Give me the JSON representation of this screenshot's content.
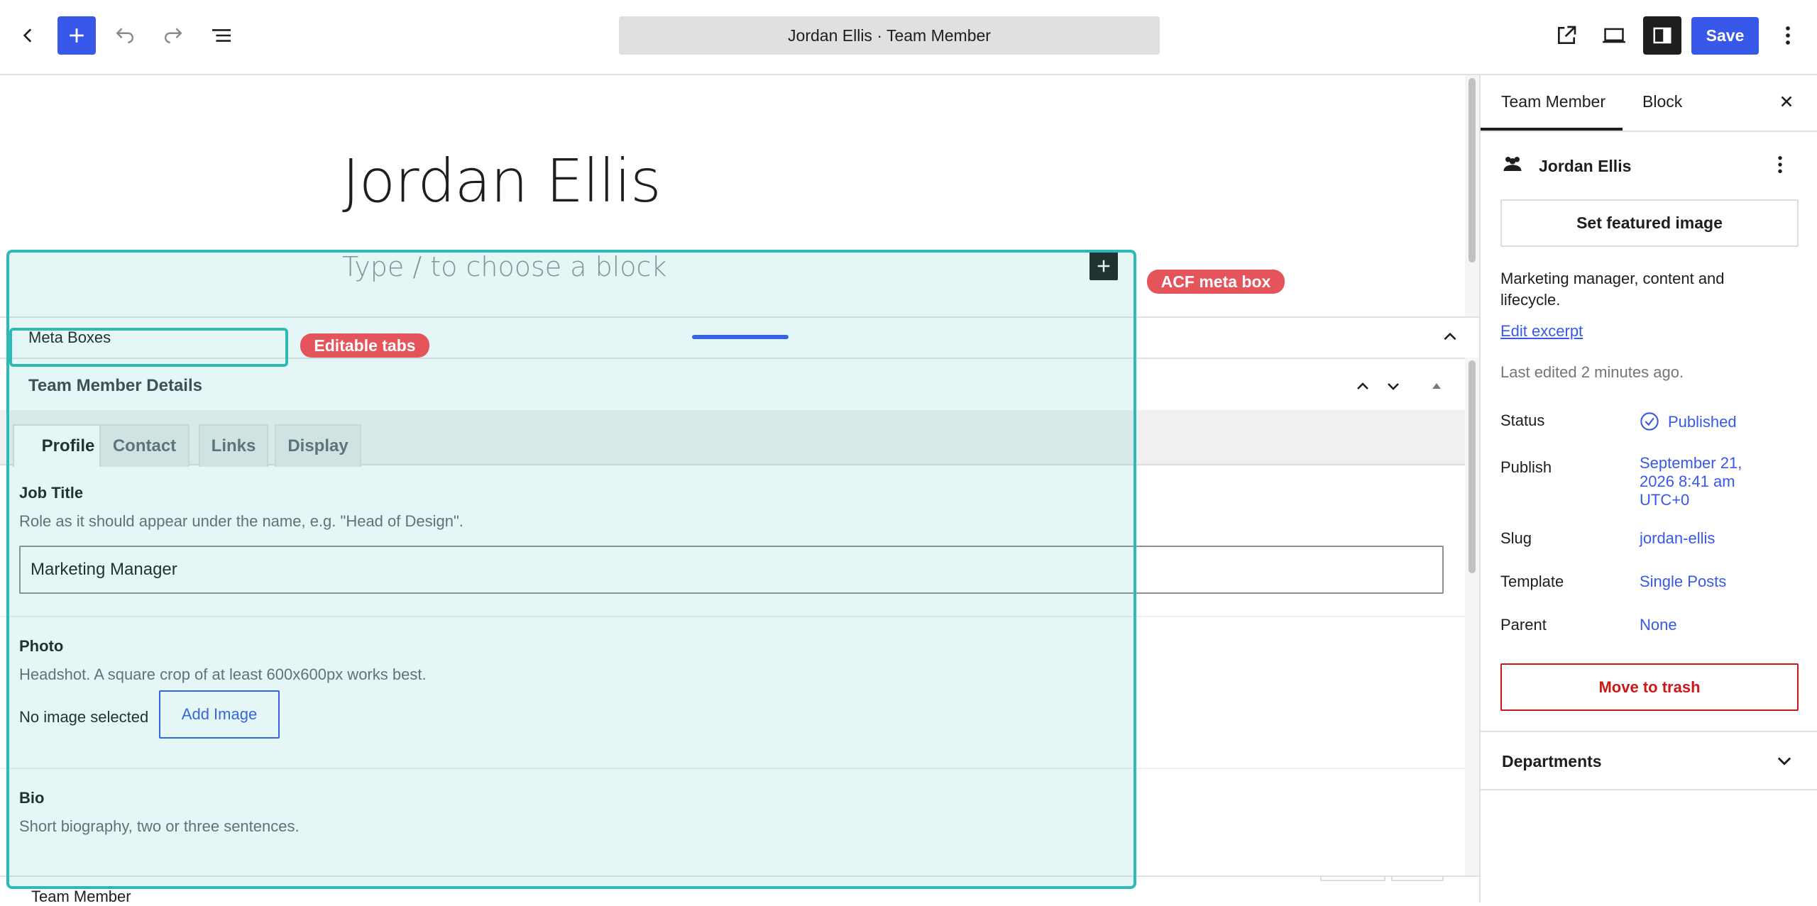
{
  "header": {
    "document_title": "Jordan Ellis · Team Member",
    "save_label": "Save"
  },
  "editor": {
    "post_title": "Jordan Ellis",
    "block_placeholder": "Type / to choose a block"
  },
  "meta_boxes": {
    "section_label": "Meta Boxes",
    "box_title": "Team Member Details",
    "tabs": [
      {
        "label": "Profile",
        "active": true
      },
      {
        "label": "Contact",
        "active": false
      },
      {
        "label": "Links",
        "active": false
      },
      {
        "label": "Display",
        "active": false
      }
    ],
    "fields": {
      "job_title": {
        "label": "Job Title",
        "description": "Role as it should appear under the name, e.g. \"Head of Design\".",
        "value": "Marketing Manager"
      },
      "photo": {
        "label": "Photo",
        "description": "Headshot. A square crop of at least 600x600px works best.",
        "status": "No image selected",
        "button": "Add Image"
      },
      "bio": {
        "label": "Bio",
        "description": "Short biography, two or three sentences."
      }
    }
  },
  "footer": {
    "breadcrumb": "Team Member"
  },
  "annotations": {
    "acf_meta_box": "ACF meta box",
    "editable_tabs": "Editable tabs"
  },
  "sidebar": {
    "tabs": [
      {
        "label": "Team Member",
        "active": true
      },
      {
        "label": "Block",
        "active": false
      }
    ],
    "post_name": "Jordan Ellis",
    "featured_image_button": "Set featured image",
    "excerpt": "Marketing manager, content and lifecycle.",
    "edit_excerpt": "Edit excerpt",
    "last_edited": "Last edited 2 minutes ago.",
    "rows": {
      "status": {
        "label": "Status",
        "value": "Published"
      },
      "publish": {
        "label": "Publish",
        "value": "September 21, 2026 8:41 am UTC+0"
      },
      "slug": {
        "label": "Slug",
        "value": "jordan-ellis"
      },
      "template": {
        "label": "Template",
        "value": "Single Posts"
      },
      "parent": {
        "label": "Parent",
        "value": "None"
      }
    },
    "trash_button": "Move to trash",
    "departments": "Departments"
  },
  "colors": {
    "accent": "#3858e9",
    "annotation_teal": "#2dbab6",
    "annotation_red": "#e5535b",
    "danger": "#cc1818"
  },
  "icons": [
    "back-chevron-icon",
    "plus-icon",
    "undo-icon",
    "redo-icon",
    "list-view-icon",
    "external-link-icon",
    "preview-device-icon",
    "sidebar-toggle-icon",
    "kebab-icon",
    "close-icon",
    "people-icon",
    "check-circle-icon",
    "chevron-up-icon",
    "chevron-down-icon",
    "triangle-up-icon"
  ]
}
